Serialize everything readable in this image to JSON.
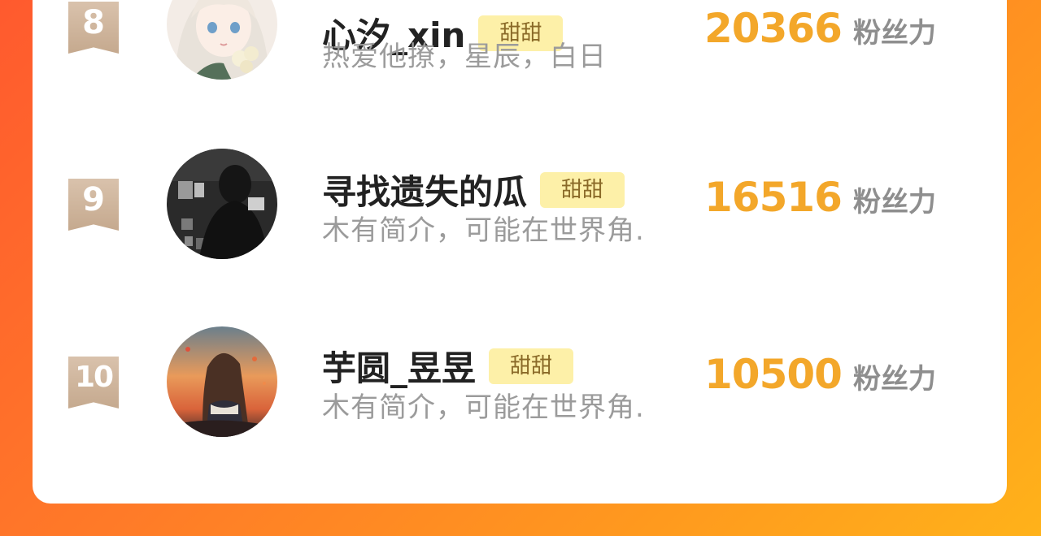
{
  "colors": {
    "background_gradient": [
      "#ff5a2e",
      "#ffb21a"
    ],
    "card": "#ffffff",
    "rank_flag": "#c5a98e",
    "tag_bg": "#fdf0a8",
    "tag_text": "#8a6a28",
    "score": "#f3a72a",
    "name": "#222222",
    "bio": "#9b9b9b"
  },
  "ranking": {
    "score_unit": "粉丝力",
    "entries": [
      {
        "rank": "8",
        "name": "心汐_xin",
        "tag": "甜甜",
        "bio": "热爱他撩，星辰，白日",
        "score": "20366",
        "avatar_icon": "anime-girl-avatar"
      },
      {
        "rank": "9",
        "name": "寻找遗失的瓜",
        "tag": "甜甜",
        "bio": "木有简介，可能在世界角.",
        "score": "16516",
        "avatar_icon": "dark-photo-avatar"
      },
      {
        "rank": "10",
        "name": "芋圆_昱昱",
        "tag": "甜甜",
        "bio": "木有简介，可能在世界角.",
        "score": "10500",
        "avatar_icon": "sunset-girl-avatar"
      }
    ]
  }
}
